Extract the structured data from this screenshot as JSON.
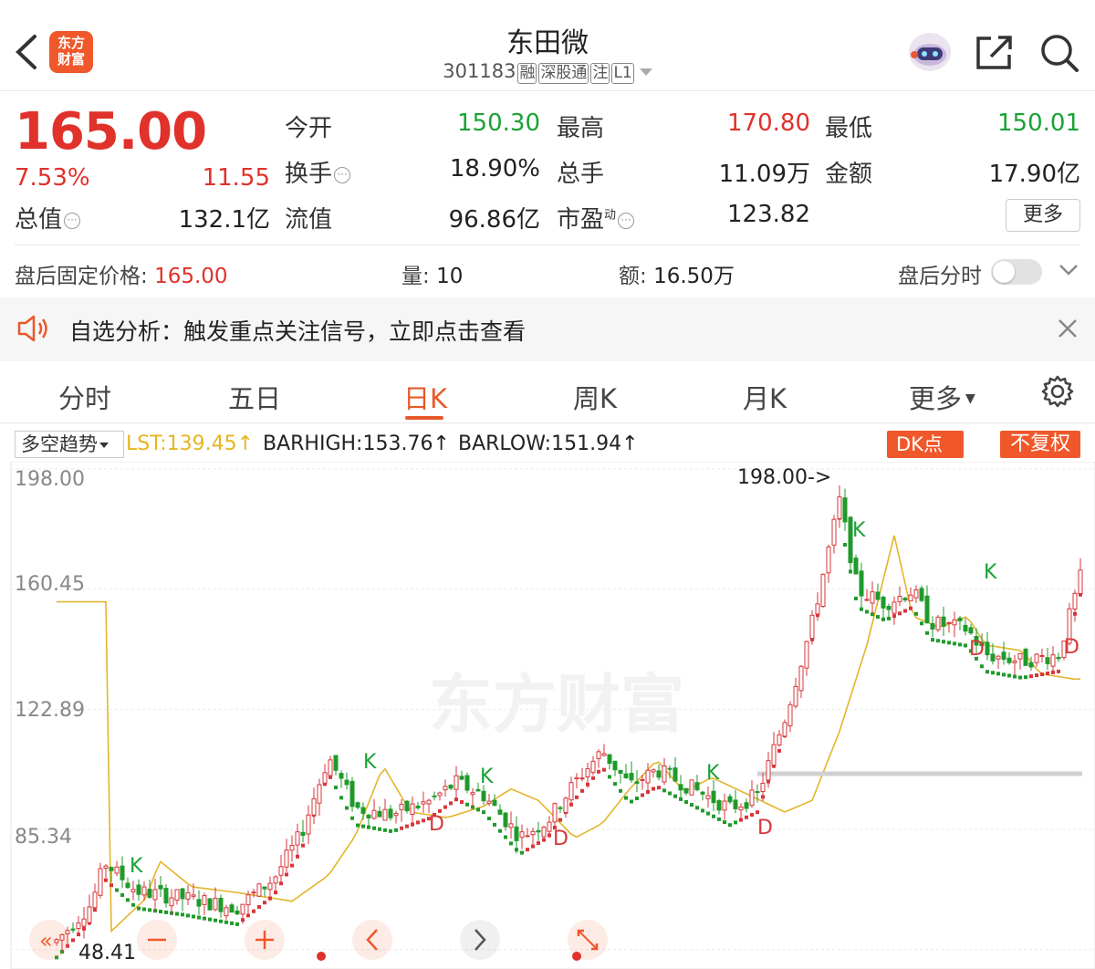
{
  "header": {
    "title": "东田微",
    "code": "301183",
    "tags": [
      "融",
      "深股通",
      "注",
      "L1"
    ],
    "logo_text_1": "东方",
    "logo_text_2": "财富"
  },
  "quote": {
    "price": "165.00",
    "change_pct": "7.53%",
    "change": "11.55",
    "fields": {
      "open_label": "今开",
      "open": "150.30",
      "high_label": "最高",
      "high": "170.80",
      "low_label": "最低",
      "low": "150.01",
      "turnover_label": "换手",
      "turnover": "18.90%",
      "volume_label": "总手",
      "volume": "11.09万",
      "amount_label": "金额",
      "amount": "17.90亿",
      "mktcap_label": "总值",
      "mktcap": "132.1亿",
      "float_label": "流值",
      "float": "96.86亿",
      "pe_label": "市盈",
      "pe_sup": "动",
      "pe": "123.82"
    },
    "more_label": "更多"
  },
  "after_hours": {
    "price_label": "盘后固定价格: ",
    "price": "165.00",
    "vol_label": "量: ",
    "vol": "10",
    "amt_label": "额: ",
    "amt": "16.50万",
    "timeshare_label": "盘后分时"
  },
  "notice": {
    "text": "自选分析：触发重点关注信号，立即点击查看"
  },
  "tabs": [
    "分时",
    "五日",
    "日K",
    "周K",
    "月K",
    "更多"
  ],
  "active_tab": 2,
  "indicator": {
    "select": "多空趋势",
    "lst": "LST:139.45↑",
    "barhigh": "BARHIGH:153.76↑",
    "barlow": "BARLOW:151.94↑",
    "dk_label": "DK点",
    "fq_label": "不复权"
  },
  "chart_data": {
    "type": "candlestick",
    "y_ticks": [
      "198.00",
      "160.45",
      "122.89",
      "85.34"
    ],
    "ylim": [
      44,
      198
    ],
    "annotations": {
      "max_label": "198.00->",
      "min_label": "48.41"
    },
    "signals_k": "K",
    "signals_d": "D",
    "colors": {
      "up": "#d7363a",
      "down": "#1f9a2a",
      "ma": "#e3b52b"
    }
  }
}
